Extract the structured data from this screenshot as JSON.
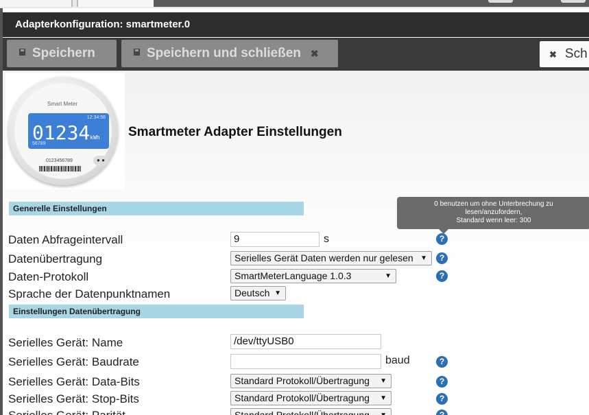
{
  "window": {
    "title": "Adapterkonfiguration: smartmeter.0"
  },
  "toolbar": {
    "save_label": "Speichern",
    "save_close_label": "Speichern und schließen",
    "close_label": "Sch"
  },
  "logo": {
    "brand_text": "Smart Meter",
    "time": "12:34:56",
    "digits": "01234",
    "unit": "kWh",
    "small_value": "56789",
    "serial": "0123456789"
  },
  "page": {
    "heading": "Smartmeter Adapter Einstellungen"
  },
  "sections": {
    "general": "Generelle Einstellungen",
    "transfer": "Einstellungen Datenübertragung"
  },
  "tooltip": {
    "line1": "0 benutzen um ohne Unterbrechung zu",
    "line2": "lesen/anzufordern,",
    "line3": "Standard wenn leer: 300"
  },
  "fields": {
    "interval": {
      "label": "Daten Abfrageintervall",
      "value": "9",
      "unit": "s"
    },
    "transfer": {
      "label": "Datenübertragung",
      "value": "Serielles Gerät Daten werden nur gelesen"
    },
    "protocol": {
      "label": "Daten-Protokoll",
      "value": "SmartMeterLanguage 1.0.3"
    },
    "language": {
      "label": "Sprache der Datenpunktnamen",
      "value": "Deutsch"
    },
    "serial_name": {
      "label": "Serielles Gerät: Name",
      "value": "/dev/ttyUSB0"
    },
    "baudrate": {
      "label": "Serielles Gerät: Baudrate",
      "value": "",
      "unit": "baud"
    },
    "databits": {
      "label": "Serielles Gerät: Data-Bits",
      "value": "Standard Protokoll/Übertragung"
    },
    "stopbits": {
      "label": "Serielles Gerät: Stop-Bits",
      "value": "Standard Protokoll/Übertragung"
    },
    "parity": {
      "label": "Serielles Gerät: Parität",
      "value": "Standard Protokoll/Übertragung"
    }
  },
  "help_icon_glyph": "?",
  "select_arrow_glyph": "▼",
  "colors": {
    "section_bar": "#a8d6e6",
    "help_icon": "#2c6fb5",
    "titlebar": "#2d2d2d"
  }
}
